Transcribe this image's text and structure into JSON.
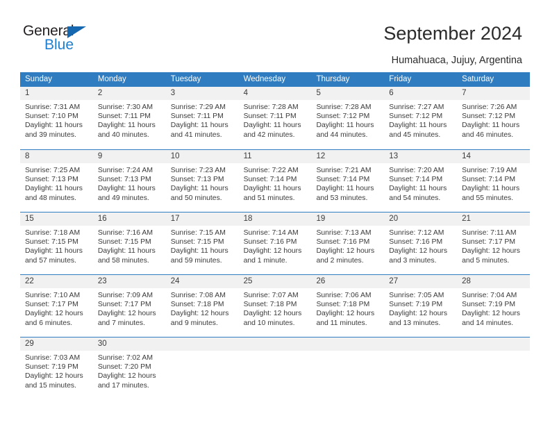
{
  "brand": {
    "name_top": "General",
    "name_bottom": "Blue",
    "color_dark": "#231f20",
    "color_blue": "#1f7fd0",
    "triangle_color": "#1568b0"
  },
  "header": {
    "title": "September 2024",
    "subtitle": "Humahuaca, Jujuy, Argentina"
  },
  "calendar": {
    "accent_color": "#2f7cc0",
    "daynum_band_color": "#f1f1f1",
    "weekdays": [
      "Sunday",
      "Monday",
      "Tuesday",
      "Wednesday",
      "Thursday",
      "Friday",
      "Saturday"
    ],
    "weeks": [
      [
        {
          "day": "1",
          "sunrise": "Sunrise: 7:31 AM",
          "sunset": "Sunset: 7:10 PM",
          "daylight1": "Daylight: 11 hours",
          "daylight2": "and 39 minutes."
        },
        {
          "day": "2",
          "sunrise": "Sunrise: 7:30 AM",
          "sunset": "Sunset: 7:11 PM",
          "daylight1": "Daylight: 11 hours",
          "daylight2": "and 40 minutes."
        },
        {
          "day": "3",
          "sunrise": "Sunrise: 7:29 AM",
          "sunset": "Sunset: 7:11 PM",
          "daylight1": "Daylight: 11 hours",
          "daylight2": "and 41 minutes."
        },
        {
          "day": "4",
          "sunrise": "Sunrise: 7:28 AM",
          "sunset": "Sunset: 7:11 PM",
          "daylight1": "Daylight: 11 hours",
          "daylight2": "and 42 minutes."
        },
        {
          "day": "5",
          "sunrise": "Sunrise: 7:28 AM",
          "sunset": "Sunset: 7:12 PM",
          "daylight1": "Daylight: 11 hours",
          "daylight2": "and 44 minutes."
        },
        {
          "day": "6",
          "sunrise": "Sunrise: 7:27 AM",
          "sunset": "Sunset: 7:12 PM",
          "daylight1": "Daylight: 11 hours",
          "daylight2": "and 45 minutes."
        },
        {
          "day": "7",
          "sunrise": "Sunrise: 7:26 AM",
          "sunset": "Sunset: 7:12 PM",
          "daylight1": "Daylight: 11 hours",
          "daylight2": "and 46 minutes."
        }
      ],
      [
        {
          "day": "8",
          "sunrise": "Sunrise: 7:25 AM",
          "sunset": "Sunset: 7:13 PM",
          "daylight1": "Daylight: 11 hours",
          "daylight2": "and 48 minutes."
        },
        {
          "day": "9",
          "sunrise": "Sunrise: 7:24 AM",
          "sunset": "Sunset: 7:13 PM",
          "daylight1": "Daylight: 11 hours",
          "daylight2": "and 49 minutes."
        },
        {
          "day": "10",
          "sunrise": "Sunrise: 7:23 AM",
          "sunset": "Sunset: 7:13 PM",
          "daylight1": "Daylight: 11 hours",
          "daylight2": "and 50 minutes."
        },
        {
          "day": "11",
          "sunrise": "Sunrise: 7:22 AM",
          "sunset": "Sunset: 7:14 PM",
          "daylight1": "Daylight: 11 hours",
          "daylight2": "and 51 minutes."
        },
        {
          "day": "12",
          "sunrise": "Sunrise: 7:21 AM",
          "sunset": "Sunset: 7:14 PM",
          "daylight1": "Daylight: 11 hours",
          "daylight2": "and 53 minutes."
        },
        {
          "day": "13",
          "sunrise": "Sunrise: 7:20 AM",
          "sunset": "Sunset: 7:14 PM",
          "daylight1": "Daylight: 11 hours",
          "daylight2": "and 54 minutes."
        },
        {
          "day": "14",
          "sunrise": "Sunrise: 7:19 AM",
          "sunset": "Sunset: 7:14 PM",
          "daylight1": "Daylight: 11 hours",
          "daylight2": "and 55 minutes."
        }
      ],
      [
        {
          "day": "15",
          "sunrise": "Sunrise: 7:18 AM",
          "sunset": "Sunset: 7:15 PM",
          "daylight1": "Daylight: 11 hours",
          "daylight2": "and 57 minutes."
        },
        {
          "day": "16",
          "sunrise": "Sunrise: 7:16 AM",
          "sunset": "Sunset: 7:15 PM",
          "daylight1": "Daylight: 11 hours",
          "daylight2": "and 58 minutes."
        },
        {
          "day": "17",
          "sunrise": "Sunrise: 7:15 AM",
          "sunset": "Sunset: 7:15 PM",
          "daylight1": "Daylight: 11 hours",
          "daylight2": "and 59 minutes."
        },
        {
          "day": "18",
          "sunrise": "Sunrise: 7:14 AM",
          "sunset": "Sunset: 7:16 PM",
          "daylight1": "Daylight: 12 hours",
          "daylight2": "and 1 minute."
        },
        {
          "day": "19",
          "sunrise": "Sunrise: 7:13 AM",
          "sunset": "Sunset: 7:16 PM",
          "daylight1": "Daylight: 12 hours",
          "daylight2": "and 2 minutes."
        },
        {
          "day": "20",
          "sunrise": "Sunrise: 7:12 AM",
          "sunset": "Sunset: 7:16 PM",
          "daylight1": "Daylight: 12 hours",
          "daylight2": "and 3 minutes."
        },
        {
          "day": "21",
          "sunrise": "Sunrise: 7:11 AM",
          "sunset": "Sunset: 7:17 PM",
          "daylight1": "Daylight: 12 hours",
          "daylight2": "and 5 minutes."
        }
      ],
      [
        {
          "day": "22",
          "sunrise": "Sunrise: 7:10 AM",
          "sunset": "Sunset: 7:17 PM",
          "daylight1": "Daylight: 12 hours",
          "daylight2": "and 6 minutes."
        },
        {
          "day": "23",
          "sunrise": "Sunrise: 7:09 AM",
          "sunset": "Sunset: 7:17 PM",
          "daylight1": "Daylight: 12 hours",
          "daylight2": "and 7 minutes."
        },
        {
          "day": "24",
          "sunrise": "Sunrise: 7:08 AM",
          "sunset": "Sunset: 7:18 PM",
          "daylight1": "Daylight: 12 hours",
          "daylight2": "and 9 minutes."
        },
        {
          "day": "25",
          "sunrise": "Sunrise: 7:07 AM",
          "sunset": "Sunset: 7:18 PM",
          "daylight1": "Daylight: 12 hours",
          "daylight2": "and 10 minutes."
        },
        {
          "day": "26",
          "sunrise": "Sunrise: 7:06 AM",
          "sunset": "Sunset: 7:18 PM",
          "daylight1": "Daylight: 12 hours",
          "daylight2": "and 11 minutes."
        },
        {
          "day": "27",
          "sunrise": "Sunrise: 7:05 AM",
          "sunset": "Sunset: 7:19 PM",
          "daylight1": "Daylight: 12 hours",
          "daylight2": "and 13 minutes."
        },
        {
          "day": "28",
          "sunrise": "Sunrise: 7:04 AM",
          "sunset": "Sunset: 7:19 PM",
          "daylight1": "Daylight: 12 hours",
          "daylight2": "and 14 minutes."
        }
      ],
      [
        {
          "day": "29",
          "sunrise": "Sunrise: 7:03 AM",
          "sunset": "Sunset: 7:19 PM",
          "daylight1": "Daylight: 12 hours",
          "daylight2": "and 15 minutes."
        },
        {
          "day": "30",
          "sunrise": "Sunrise: 7:02 AM",
          "sunset": "Sunset: 7:20 PM",
          "daylight1": "Daylight: 12 hours",
          "daylight2": "and 17 minutes."
        },
        {
          "day": "",
          "sunrise": "",
          "sunset": "",
          "daylight1": "",
          "daylight2": ""
        },
        {
          "day": "",
          "sunrise": "",
          "sunset": "",
          "daylight1": "",
          "daylight2": ""
        },
        {
          "day": "",
          "sunrise": "",
          "sunset": "",
          "daylight1": "",
          "daylight2": ""
        },
        {
          "day": "",
          "sunrise": "",
          "sunset": "",
          "daylight1": "",
          "daylight2": ""
        },
        {
          "day": "",
          "sunrise": "",
          "sunset": "",
          "daylight1": "",
          "daylight2": ""
        }
      ]
    ]
  }
}
